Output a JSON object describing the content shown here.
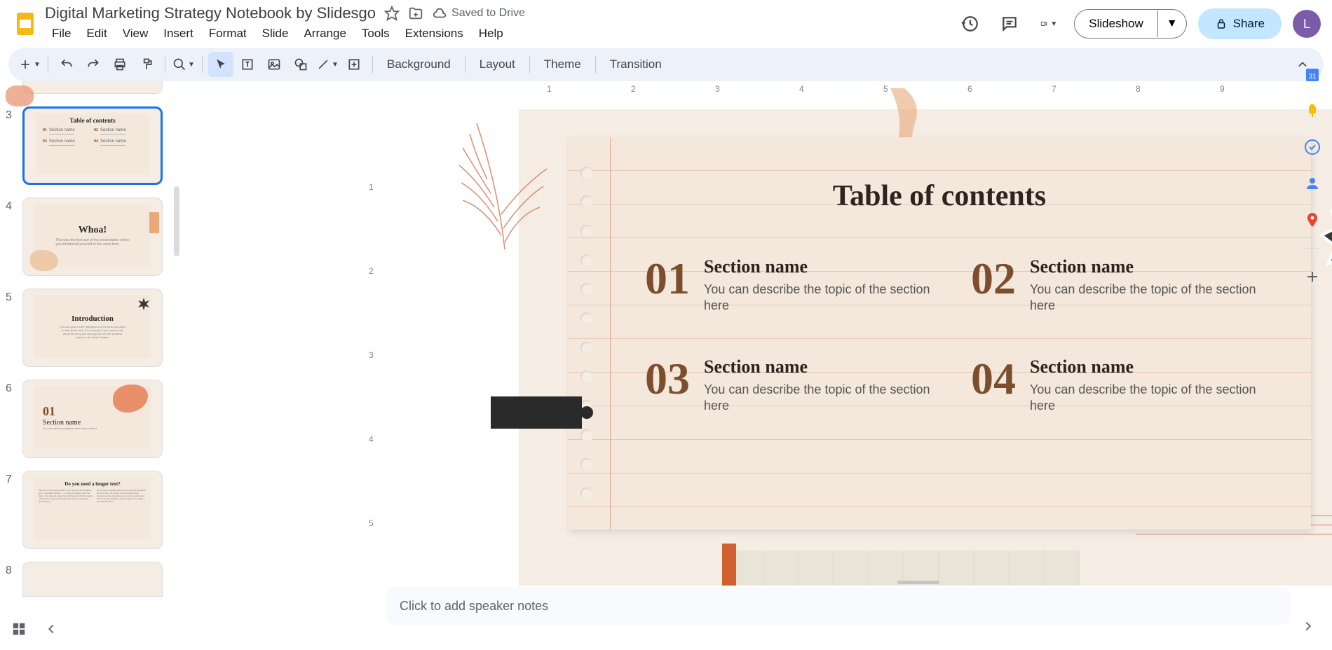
{
  "doc_title": "Digital Marketing Strategy Notebook by Slidesgo",
  "saved_status": "Saved to Drive",
  "menu": [
    "File",
    "Edit",
    "View",
    "Insert",
    "Format",
    "Slide",
    "Arrange",
    "Tools",
    "Extensions",
    "Help"
  ],
  "header_buttons": {
    "slideshow": "Slideshow",
    "share": "Share"
  },
  "avatar_letter": "L",
  "toolbar_text": {
    "background": "Background",
    "layout": "Layout",
    "theme": "Theme",
    "transition": "Transition"
  },
  "ruler_marks": [
    "1",
    "2",
    "3",
    "4",
    "5",
    "6",
    "7",
    "8",
    "9"
  ],
  "ruler_v_marks": [
    "1",
    "2",
    "3",
    "4",
    "5"
  ],
  "filmstrip": [
    {
      "num": "3",
      "selected": true,
      "type": "toc"
    },
    {
      "num": "4",
      "selected": false,
      "type": "whoa",
      "title": "Whoa!"
    },
    {
      "num": "5",
      "selected": false,
      "type": "intro",
      "title": "Introduction"
    },
    {
      "num": "6",
      "selected": false,
      "type": "section",
      "title": "Section name",
      "num_display": "01"
    },
    {
      "num": "7",
      "selected": false,
      "type": "longer",
      "title": "Do you need a longer text?"
    },
    {
      "num": "8",
      "selected": false,
      "type": "partial"
    }
  ],
  "slide": {
    "title": "Table of contents",
    "items": [
      {
        "num": "01",
        "heading": "Section name",
        "desc": "You can describe the topic of the section here"
      },
      {
        "num": "02",
        "heading": "Section name",
        "desc": "You can describe the topic of the section here"
      },
      {
        "num": "03",
        "heading": "Section name",
        "desc": "You can describe the topic of the section here"
      },
      {
        "num": "04",
        "heading": "Section name",
        "desc": "You can describe the topic of the section here"
      }
    ]
  },
  "speaker_notes_placeholder": "Click to add speaker notes"
}
